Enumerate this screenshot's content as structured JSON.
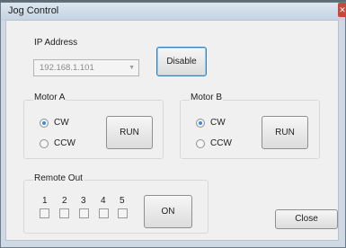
{
  "window": {
    "title": "Jog Control"
  },
  "ip": {
    "group_label": "IP Address",
    "value": "192.168.1.101",
    "disable_label": "Disable"
  },
  "motor_a": {
    "group_label": "Motor A",
    "cw_label": "CW",
    "ccw_label": "CCW",
    "selected": "CW",
    "run_label": "RUN"
  },
  "motor_b": {
    "group_label": "Motor B",
    "cw_label": "CW",
    "ccw_label": "CCW",
    "selected": "CW",
    "run_label": "RUN"
  },
  "remote_out": {
    "group_label": "Remote Out",
    "channels": [
      "1",
      "2",
      "3",
      "4",
      "5"
    ],
    "on_label": "ON"
  },
  "close_label": "Close"
}
